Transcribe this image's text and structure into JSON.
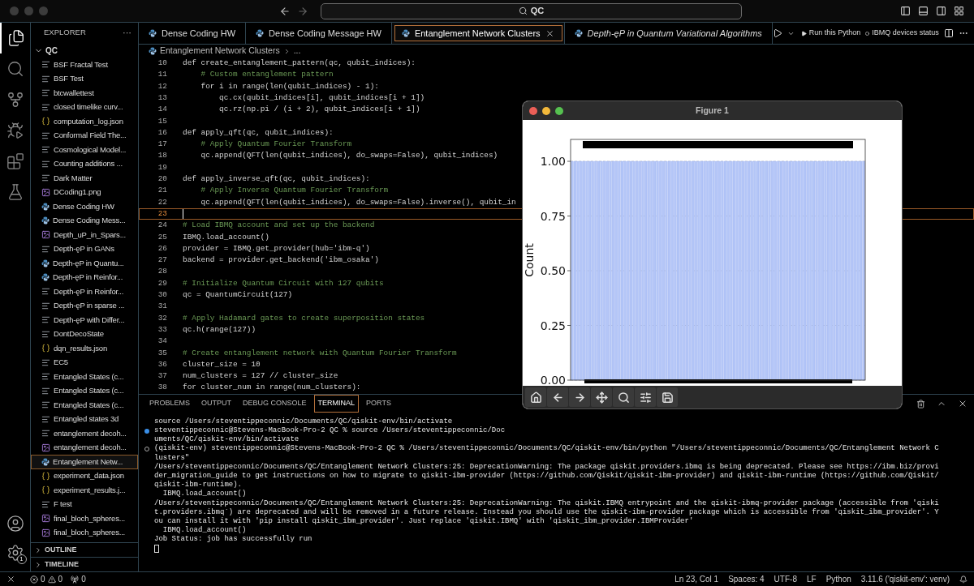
{
  "title_bar": {
    "search": "QC"
  },
  "activity_bar": {
    "items": [
      {
        "kind": "files",
        "selected": true
      },
      {
        "kind": "search",
        "selected": false
      },
      {
        "kind": "source",
        "selected": false
      },
      {
        "kind": "debug",
        "selected": false
      },
      {
        "kind": "extensions",
        "selected": false
      },
      {
        "kind": "testing",
        "selected": false
      }
    ],
    "settings_badge": "1"
  },
  "sidebar": {
    "header": "EXPLORER",
    "more": "···",
    "folder": {
      "name": "QC",
      "expanded": true
    },
    "items": [
      {
        "name": "BSF Fractal Test",
        "kind": "text",
        "selected": false
      },
      {
        "name": "BSF Test",
        "kind": "text",
        "selected": false
      },
      {
        "name": "btcwallettest",
        "kind": "text",
        "selected": false
      },
      {
        "name": "closed timelike curv...",
        "kind": "text",
        "selected": false
      },
      {
        "name": "computation_log.json",
        "kind": "json",
        "selected": false
      },
      {
        "name": "Conformal Field The...",
        "kind": "text",
        "selected": false
      },
      {
        "name": "Cosmological Model...",
        "kind": "text",
        "selected": false
      },
      {
        "name": "Counting additions ...",
        "kind": "text",
        "selected": false
      },
      {
        "name": "Dark Matter",
        "kind": "text",
        "selected": false
      },
      {
        "name": "DCoding1.png",
        "kind": "image",
        "selected": false
      },
      {
        "name": "Dense Coding HW",
        "kind": "python",
        "selected": false
      },
      {
        "name": "Dense Coding Mess...",
        "kind": "python",
        "selected": false
      },
      {
        "name": "Depth_uP_in_Spars...",
        "kind": "image",
        "selected": false
      },
      {
        "name": "Depth-ęP in GANs",
        "kind": "text",
        "selected": false
      },
      {
        "name": "Depth-ęP in Quantu...",
        "kind": "python",
        "selected": false
      },
      {
        "name": "Depth-ęP in Reinfor...",
        "kind": "python",
        "selected": false
      },
      {
        "name": "Depth-ęP in Reinfor...",
        "kind": "text",
        "selected": false
      },
      {
        "name": "Depth-ęP in sparse ...",
        "kind": "text",
        "selected": false
      },
      {
        "name": "Depth-ęP with Differ...",
        "kind": "text",
        "selected": false
      },
      {
        "name": "DontDecoState",
        "kind": "text",
        "selected": false
      },
      {
        "name": "dqn_results.json",
        "kind": "json",
        "selected": false
      },
      {
        "name": "EC5",
        "kind": "text",
        "selected": false
      },
      {
        "name": "Entangled States (c...",
        "kind": "text",
        "selected": false
      },
      {
        "name": "Entangled States (c...",
        "kind": "text",
        "selected": false
      },
      {
        "name": "Entangled States (c...",
        "kind": "text",
        "selected": false
      },
      {
        "name": "Entangled states 3d",
        "kind": "text",
        "selected": false
      },
      {
        "name": "entanglement decoh...",
        "kind": "text",
        "selected": false
      },
      {
        "name": "entanglement decoh...",
        "kind": "image",
        "selected": false
      },
      {
        "name": "Entanglement Netw...",
        "kind": "python",
        "selected": true
      },
      {
        "name": "experiment_data.json",
        "kind": "json",
        "selected": false
      },
      {
        "name": "experiment_results.j...",
        "kind": "json",
        "selected": false
      },
      {
        "name": "F test",
        "kind": "text",
        "selected": false
      },
      {
        "name": "final_bloch_spheres...",
        "kind": "image",
        "selected": false
      },
      {
        "name": "final_bloch_spheres...",
        "kind": "image",
        "selected": false
      }
    ],
    "sections": [
      {
        "label": "OUTLINE",
        "expanded": false
      },
      {
        "label": "TIMELINE",
        "expanded": false
      }
    ]
  },
  "tabs": [
    {
      "label": "Dense Coding HW",
      "selected": false,
      "preview": false
    },
    {
      "label": "Dense Coding Message HW",
      "selected": false,
      "preview": false
    },
    {
      "label": "Entanglement Network Clusters",
      "selected": true,
      "preview": false
    },
    {
      "label": "Depth-ęP in Quantum Variational Algorithms",
      "selected": false,
      "preview": true
    }
  ],
  "tab_actions": {
    "run_label": "Run this Python",
    "status_label": "IBMQ devices status"
  },
  "breadcrumb": [
    "Entanglement Network Clusters",
    "..."
  ],
  "code": [
    {
      "n": "10",
      "text": "def create_entanglement_pattern(qc, qubit_indices):",
      "kind": "code",
      "current": false
    },
    {
      "n": "11",
      "text": "    # Custom entanglement pattern",
      "kind": "comment",
      "current": false
    },
    {
      "n": "12",
      "text": "    for i in range(len(qubit_indices) - 1):",
      "kind": "code",
      "current": false
    },
    {
      "n": "13",
      "text": "        qc.cx(qubit_indices[i], qubit_indices[i + 1])",
      "kind": "code",
      "current": false
    },
    {
      "n": "14",
      "text": "        qc.rz(np.pi / (i + 2), qubit_indices[i + 1])",
      "kind": "code",
      "current": false
    },
    {
      "n": "15",
      "current": false
    },
    {
      "n": "16",
      "text": "def apply_qft(qc, qubit_indices):",
      "kind": "code",
      "current": false
    },
    {
      "n": "17",
      "text": "    # Apply Quantum Fourier Transform",
      "kind": "comment",
      "current": false
    },
    {
      "n": "18",
      "text": "    qc.append(QFT(len(qubit_indices), do_swaps=False), qubit_indices)",
      "kind": "code",
      "current": false
    },
    {
      "n": "19",
      "current": false
    },
    {
      "n": "20",
      "text": "def apply_inverse_qft(qc, qubit_indices):",
      "kind": "code",
      "current": false
    },
    {
      "n": "21",
      "text": "    # Apply Inverse Quantum Fourier Transform",
      "kind": "comment",
      "current": false
    },
    {
      "n": "22",
      "text": "    qc.append(QFT(len(qubit_indices), do_swaps=False).inverse(), qubit_in",
      "kind": "code",
      "current": false
    },
    {
      "n": "23",
      "current": true
    },
    {
      "n": "24",
      "text": "# Load IBMQ account and set up the backend",
      "kind": "comment",
      "current": false
    },
    {
      "n": "25",
      "text": "IBMQ.load_account()",
      "kind": "code",
      "current": false
    },
    {
      "n": "26",
      "text": "provider = IBMQ.get_provider(hub='ibm-q')",
      "kind": "code",
      "current": false
    },
    {
      "n": "27",
      "text": "backend = provider.get_backend('ibm_osaka')",
      "kind": "code",
      "current": false
    },
    {
      "n": "28",
      "current": false
    },
    {
      "n": "29",
      "text": "# Initialize Quantum Circuit with 127 qubits",
      "kind": "comment",
      "current": false
    },
    {
      "n": "30",
      "text": "qc = QuantumCircuit(127)",
      "kind": "code",
      "current": false
    },
    {
      "n": "31",
      "current": false
    },
    {
      "n": "32",
      "text": "# Apply Hadamard gates to create superposition states",
      "kind": "comment",
      "current": false
    },
    {
      "n": "33",
      "text": "qc.h(range(127))",
      "kind": "code",
      "current": false
    },
    {
      "n": "34",
      "current": false
    },
    {
      "n": "35",
      "text": "# Create entanglement network with Quantum Fourier Transform",
      "kind": "comment",
      "current": false
    },
    {
      "n": "36",
      "text": "cluster_size = 10",
      "kind": "code",
      "current": false
    },
    {
      "n": "37",
      "text": "num_clusters = 127 // cluster_size",
      "kind": "code",
      "current": false
    },
    {
      "n": "38",
      "text": "for cluster_num in range(num_clusters):",
      "kind": "code",
      "current": false
    }
  ],
  "panel": {
    "tabs": [
      {
        "label": "PROBLEMS",
        "selected": false
      },
      {
        "label": "OUTPUT",
        "selected": false
      },
      {
        "label": "DEBUG CONSOLE",
        "selected": false
      },
      {
        "label": "TERMINAL",
        "selected": true
      },
      {
        "label": "PORTS",
        "selected": false
      }
    ],
    "terminal": [
      {
        "text": "source /Users/steventippeconnic/Documents/QC/qiskit-env/bin/activate",
        "kind": "output"
      },
      {
        "text": "steventippeconnic@Stevens-MacBook-Pro-2 QC % source /Users/steventippeconnic/Doc",
        "kind": "command_done"
      },
      {
        "text": "uments/QC/qiskit-env/bin/activate",
        "kind": "output"
      },
      {
        "text": "(qiskit-env) steventippeconnic@Stevens-MacBook-Pro-2 QC % /Users/steventippeconnic/Documents/QC/qiskit-env/bin/python \"/Users/steventippeconnic/Documents/QC/Entanglement Network C",
        "kind": "command_running"
      },
      {
        "text": "lusters\"",
        "kind": "output"
      },
      {
        "text": "/Users/steventippeconnic/Documents/QC/Entanglement Network Clusters:25: DeprecationWarning: The package qiskit.providers.ibmq is being deprecated. Please see https://ibm.biz/provi",
        "kind": "output"
      },
      {
        "text": "der_migration_guide to get instructions on how to migrate to qiskit-ibm-provider (https://github.com/Qiskit/qiskit-ibm-provider) and qiskit-ibm-runtime (https://github.com/Qiskit/",
        "kind": "output"
      },
      {
        "text": "qiskit-ibm-runtime).",
        "kind": "output"
      },
      {
        "text": "  IBMQ.load_account()",
        "kind": "output"
      },
      {
        "text": "/Users/steventippeconnic/Documents/QC/Entanglement Network Clusters:25: DeprecationWarning: The qiskit.IBMQ entrypoint and the qiskit-ibmq-provider package (accessible from 'qiski",
        "kind": "output"
      },
      {
        "text": "t.providers.ibmq`) are deprecated and will be removed in a future release. Instead you should use the qiskit-ibm-provider package which is accessible from 'qiskit_ibm_provider'. Y",
        "kind": "output"
      },
      {
        "text": "ou can install it with 'pip install qiskit_ibm_provider'. Just replace 'qiskit.IBMQ' with 'qiskit_ibm_provider.IBMProvider'",
        "kind": "output"
      },
      {
        "text": "  IBMQ.load_account()",
        "kind": "output"
      },
      {
        "text": "Job Status: job has successfully run",
        "kind": "output"
      }
    ]
  },
  "figure": {
    "title": "Figure 1",
    "chart_data": {
      "type": "bar",
      "ylabel": "Count",
      "ylim": [
        0,
        1.1
      ],
      "grid": true,
      "yticks": [
        {
          "value": 0,
          "label": "0.00"
        },
        {
          "value": 0.25,
          "label": "0.25"
        },
        {
          "value": 0.5,
          "label": "0.50"
        },
        {
          "value": 0.75,
          "label": "0.75"
        },
        {
          "value": 1,
          "label": "1.00"
        }
      ],
      "values": [
        1,
        1,
        1,
        1,
        1,
        1,
        1,
        1,
        1,
        1,
        1,
        1,
        1,
        1,
        1,
        1,
        1,
        1,
        1,
        1,
        1,
        1,
        1,
        1,
        1,
        1,
        1,
        1,
        1,
        1,
        1,
        1,
        1,
        1,
        1,
        1,
        1,
        1,
        1,
        1,
        1,
        1,
        1,
        1,
        1,
        1,
        1,
        1,
        1,
        1,
        1,
        1,
        1,
        1,
        1,
        1,
        1,
        1,
        1,
        1,
        1,
        1,
        1,
        1,
        1,
        1,
        1,
        1,
        1,
        1,
        1,
        1,
        1,
        1,
        1,
        1,
        1,
        1,
        1,
        1,
        1,
        1,
        1,
        1,
        1,
        1,
        1,
        1,
        1,
        1,
        1,
        1,
        1,
        1,
        1,
        1,
        1,
        1,
        1,
        1
      ]
    }
  },
  "status_bar": {
    "errors": "0",
    "warnings": "0",
    "ports": "0",
    "items": [
      "Ln 23, Col 1",
      "Spaces: 4",
      "UTF-8",
      "LF",
      "Python",
      "3.11.6 ('qiskit-env': venv)"
    ]
  }
}
